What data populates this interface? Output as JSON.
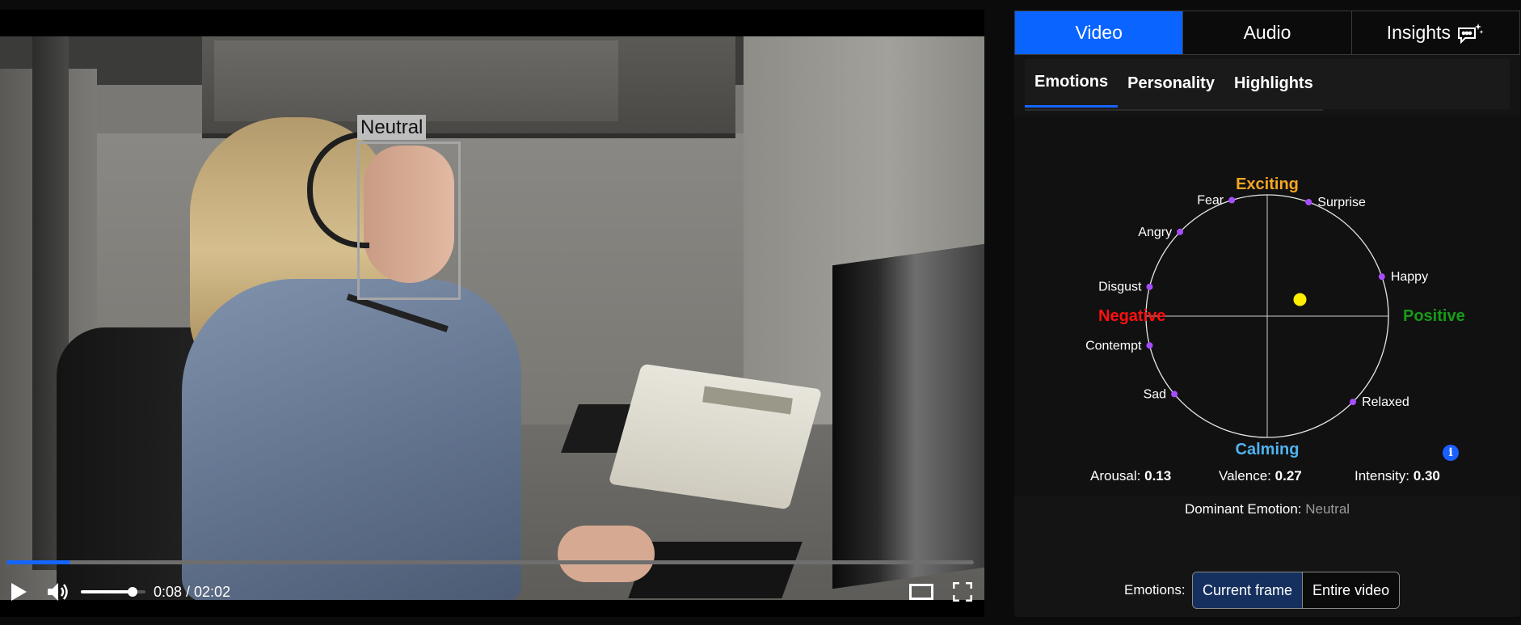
{
  "video": {
    "face_label": "Neutral",
    "time": "0:08 / 02:02",
    "progress_fraction": 0.066,
    "volume_fraction": 0.8,
    "icons": {
      "play": "play-icon",
      "volume": "volume-icon",
      "theater": "theater-mode-icon",
      "fullscreen": "fullscreen-icon"
    },
    "accent_color": "#1565ff"
  },
  "tabs": {
    "items": [
      {
        "label": "Video",
        "active": true
      },
      {
        "label": "Audio",
        "active": false
      },
      {
        "label": "Insights",
        "active": false,
        "icon": "sparkle-chat-icon"
      }
    ],
    "active_color": "#0a64ff"
  },
  "subtabs": {
    "items": [
      {
        "label": "Emotions",
        "active": true
      },
      {
        "label": "Personality",
        "active": false
      },
      {
        "label": "Highlights",
        "active": false
      }
    ]
  },
  "wheel": {
    "axis_labels": {
      "top": "Exciting",
      "bottom": "Calming",
      "left": "Negative",
      "right": "Positive"
    },
    "axis_colors": {
      "top": "#f5a623",
      "bottom": "#4fb3f0",
      "left": "#ff1010",
      "right": "#179b17"
    },
    "emotions": [
      {
        "label": "Fear",
        "angle_deg": 107
      },
      {
        "label": "Surprise",
        "angle_deg": 70
      },
      {
        "label": "Angry",
        "angle_deg": 136
      },
      {
        "label": "Happy",
        "angle_deg": 19
      },
      {
        "label": "Disgust",
        "angle_deg": 166
      },
      {
        "label": "Contempt",
        "angle_deg": 194
      },
      {
        "label": "Sad",
        "angle_deg": 220
      },
      {
        "label": "Relaxed",
        "angle_deg": 315
      }
    ],
    "point_color": "#ffee00",
    "marker_color": "#a64dff",
    "current": {
      "valence": 0.27,
      "arousal": 0.13
    }
  },
  "metrics": {
    "arousal_label": "Arousal:",
    "arousal_value": "0.13",
    "valence_label": "Valence:",
    "valence_value": "0.27",
    "intensity_label": "Intensity:",
    "intensity_value": "0.30",
    "dominant_label": "Dominant Emotion:",
    "dominant_value": "Neutral",
    "info_icon": "info-icon"
  },
  "scope": {
    "label": "Emotions:",
    "options": [
      {
        "label": "Current frame",
        "active": true
      },
      {
        "label": "Entire video",
        "active": false
      }
    ]
  }
}
